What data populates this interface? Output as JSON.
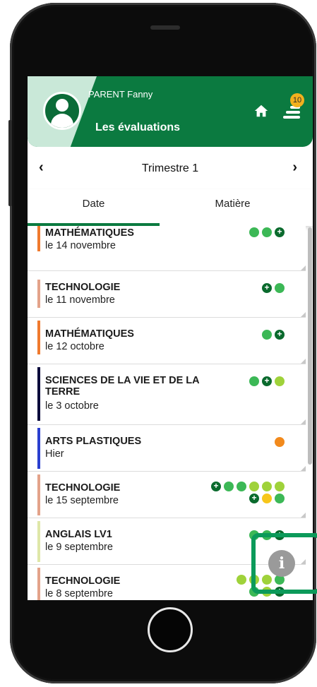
{
  "header": {
    "parent_name": "PARENT Fanny",
    "title": "Les évaluations",
    "notification_count": "10",
    "home_icon": "home-icon",
    "menu_icon": "menu-icon"
  },
  "period": {
    "title": "Trimestre 1",
    "prev": "‹",
    "next": "›"
  },
  "tabs": [
    {
      "label": "Date",
      "active": true
    },
    {
      "label": "Matière",
      "active": false
    }
  ],
  "colors": {
    "brand": "#0b7a40",
    "green": "#3cb856",
    "dark_green": "#0a6a2d",
    "light_green": "#9fd23a",
    "yellow": "#f7c61a",
    "orange": "#f28a1c"
  },
  "evaluations": [
    {
      "subject": "MATHÉMATIQUES",
      "date": "le 14 novembre",
      "bar_color": "#f07a2e",
      "dots": [
        [
          "g"
        ],
        [
          "g"
        ],
        [
          "dg+"
        ]
      ]
    },
    {
      "subject": "TECHNOLOGIE",
      "date": "le 11 novembre",
      "bar_color": "#e3a38a",
      "dots": [
        [
          "dg+"
        ],
        [
          "g"
        ]
      ]
    },
    {
      "subject": "MATHÉMATIQUES",
      "date": "le 12 octobre",
      "bar_color": "#f07a2e",
      "dots": [
        [
          "g"
        ],
        [
          "dg+"
        ]
      ]
    },
    {
      "subject": "SCIENCES DE LA VIE ET DE LA TERRE",
      "date": "le 3 octobre",
      "bar_color": "#0b0b3c",
      "dots": [
        [
          "g"
        ],
        [
          "dg+"
        ],
        [
          "lg"
        ]
      ]
    },
    {
      "subject": "ARTS PLASTIQUES",
      "date": "Hier",
      "bar_color": "#2a3fcf",
      "dots": [
        [
          "o"
        ]
      ]
    },
    {
      "subject": "TECHNOLOGIE",
      "date": "le 15 septembre",
      "bar_color": "#e3a38a",
      "dots": [
        [
          "dg+",
          "g",
          "g",
          "lg",
          "lg",
          "lg"
        ],
        [
          "dg+",
          "y",
          "g"
        ]
      ]
    },
    {
      "subject": "ANGLAIS LV1",
      "date": "le 9 septembre",
      "bar_color": "#dfe7a8",
      "dots": [
        [
          "g"
        ],
        [
          "g"
        ],
        [
          "dg+"
        ]
      ]
    },
    {
      "subject": "TECHNOLOGIE",
      "date": "le 8 septembre",
      "bar_color": "#e3a38a",
      "dots": [
        [
          "lg",
          "lg",
          "lg",
          "g"
        ],
        [
          "g",
          "lg",
          "dg+"
        ]
      ]
    }
  ],
  "info_button": {
    "icon": "info-icon",
    "label": "i"
  }
}
